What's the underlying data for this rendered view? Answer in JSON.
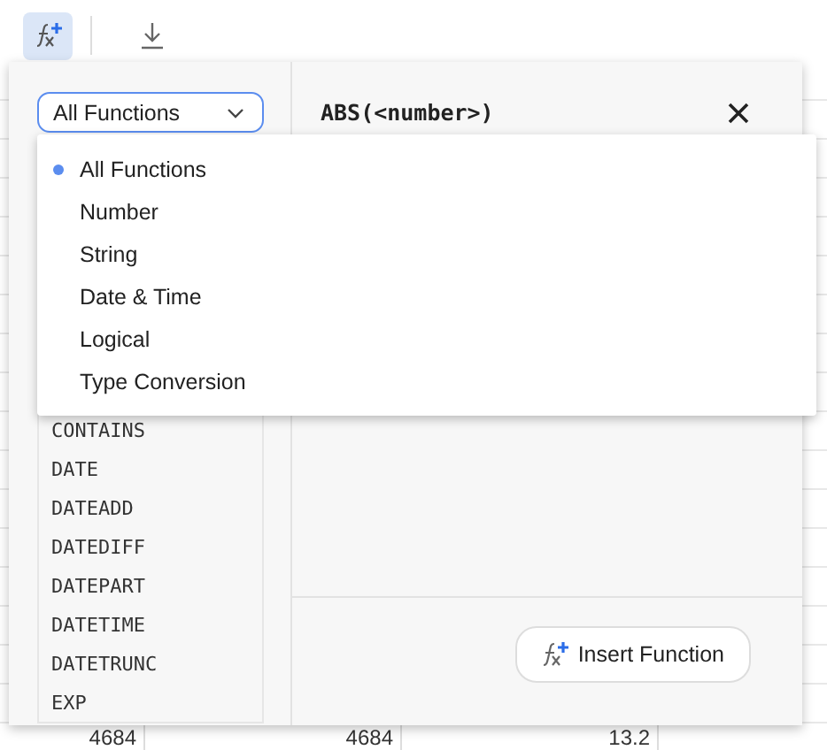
{
  "toolbar": {
    "buttons": [
      {
        "kind": "function",
        "selected": true
      },
      {
        "kind": "download",
        "selected": false
      }
    ]
  },
  "panel": {
    "category_select": {
      "value": "All Functions"
    },
    "category_menu": [
      {
        "label": "All Functions",
        "selected": true
      },
      {
        "label": "Number",
        "selected": false
      },
      {
        "label": "String",
        "selected": false
      },
      {
        "label": "Date & Time",
        "selected": false
      },
      {
        "label": "Logical",
        "selected": false
      },
      {
        "label": "Type Conversion",
        "selected": false
      }
    ],
    "functions": [
      "CONTAINS",
      "DATE",
      "DATEADD",
      "DATEDIFF",
      "DATEPART",
      "DATETIME",
      "DATETRUNC",
      "EXP"
    ],
    "signature": "ABS(<number>)",
    "insert_button": "Insert Function"
  },
  "sheet_row": [
    "4684",
    "4684",
    "13.2"
  ]
}
